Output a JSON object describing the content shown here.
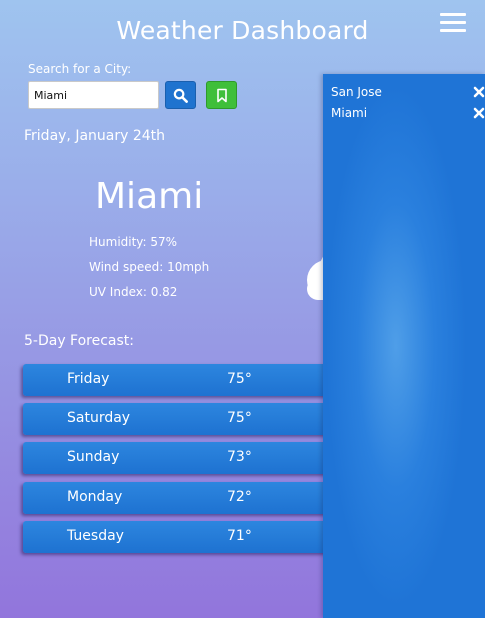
{
  "header": {
    "title": "Weather Dashboard"
  },
  "search": {
    "label": "Search for a City:",
    "value": "Miami"
  },
  "current": {
    "date": "Friday, January 24th",
    "city": "Miami",
    "humidity": "Humidity: 57%",
    "wind": "Wind speed: 10mph",
    "uv": "UV Index: 0.82"
  },
  "forecast": {
    "title": "5-Day Forecast:",
    "days": [
      {
        "day": "Friday",
        "temp": "75°"
      },
      {
        "day": "Saturday",
        "temp": "75°"
      },
      {
        "day": "Sunday",
        "temp": "73°"
      },
      {
        "day": "Monday",
        "temp": "72°"
      },
      {
        "day": "Tuesday",
        "temp": "71°"
      }
    ]
  },
  "saved_cities": [
    {
      "name": "San Jose"
    },
    {
      "name": "Miami"
    }
  ],
  "icons": {
    "menu": "hamburger-menu-icon",
    "search": "search-icon",
    "save": "bookmark-icon",
    "remove": "close-icon",
    "weather": "cloud-icon"
  },
  "colors": {
    "primary_blue": "#1f73cf",
    "save_green": "#3fbf3a",
    "text": "#ffffff"
  }
}
